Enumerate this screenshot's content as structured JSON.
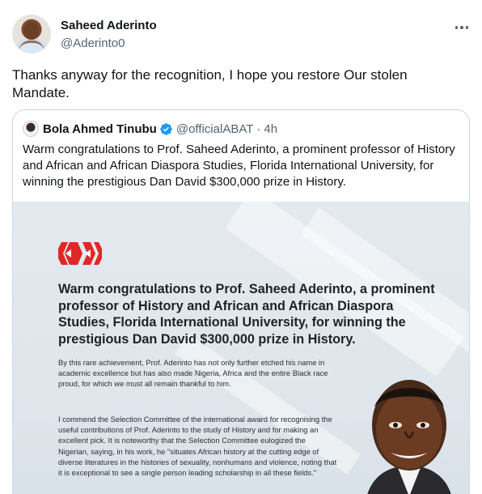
{
  "tweet": {
    "author": {
      "display_name": "Saheed Aderinto",
      "handle": "@Aderinto0"
    },
    "text": "Thanks anyway for the recognition, I hope you restore Our stolen Mandate.",
    "more_icon": "more-horizontal-icon"
  },
  "quoted_tweet": {
    "author": {
      "display_name": "Bola Ahmed Tinubu",
      "handle": "@officialABAT",
      "verified": true,
      "verified_color": "#1d9bf0"
    },
    "separator": "·",
    "time": "4h",
    "text": "Warm congratulations to Prof. Saheed Aderinto, a prominent professor of History and African and African Diaspora Studies,  Florida International University, for winning the prestigious Dan David $300,000 prize in History.",
    "image": {
      "logo_color": "#e02727",
      "headline": "Warm congratulations to Prof. Saheed Aderinto, a prominent professor of History and African and African Diaspora Studies,  Florida International University, for winning the prestigious Dan David $300,000 prize in History.",
      "paragraph_1": "By this rare achievement, Prof. Aderinto has not only further etched his name in academic excellence but has also made Nigeria, Africa and the entire Black race proud, for which we must all remain thankful to him.",
      "paragraph_2": "I commend the Selection Committee of the international award for recognising the useful contributions of Prof. Aderinto to the study of History and for making an excellent pick. It is noteworthy that the Selection Committee eulogized the Nigerian, saying, in his work, he \"situates African history at the cutting edge of diverse literatures in the histories of sexuality, nonhumans and violence, noting that it is exceptional to see a single person leading scholarship in all these fields.\""
    }
  }
}
